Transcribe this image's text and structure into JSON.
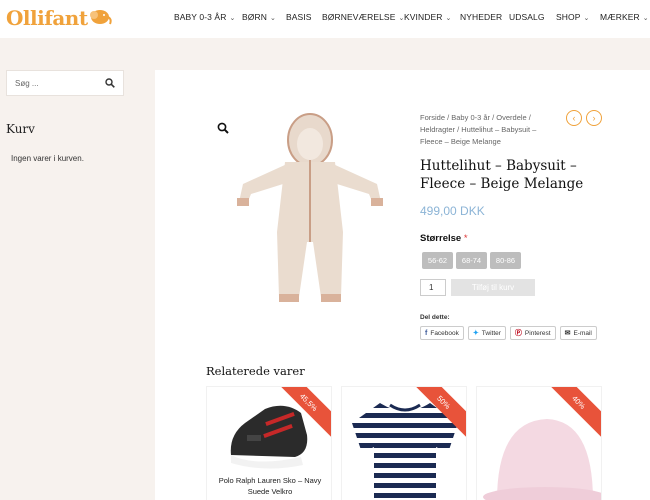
{
  "brand": {
    "name": "Ollifant",
    "accent_color": "#f0a23b"
  },
  "nav": [
    {
      "label": "BABY 0-3 ÅR",
      "has_dropdown": true
    },
    {
      "label": "BØRN",
      "has_dropdown": true
    },
    {
      "label": "BASIS",
      "has_dropdown": false
    },
    {
      "label": "BØRNEVÆRELSE",
      "has_dropdown": true
    },
    {
      "label": "KVINDER",
      "has_dropdown": true
    },
    {
      "label": "NYHEDER",
      "has_dropdown": false
    },
    {
      "label": "UDSALG",
      "has_dropdown": false
    },
    {
      "label": "SHOP",
      "has_dropdown": true
    },
    {
      "label": "MÆRKER",
      "has_dropdown": true
    }
  ],
  "sidebar": {
    "search_placeholder": "Søg ...",
    "cart_title": "Kurv",
    "cart_empty": "Ingen varer i kurven."
  },
  "product": {
    "breadcrumb": "Forside / Baby 0-3 år / Overdele / Heldragter / Huttelihut – Babysuit – Fleece – Beige Melange",
    "title": "Huttelihut – Babysuit – Fleece – Beige Melange",
    "price": "499,00 DKK",
    "price_color": "#8cb4d6",
    "size_label": "Størrelse",
    "required_mark": "*",
    "sizes": [
      "56-62",
      "68-74",
      "80-86"
    ],
    "quantity": "1",
    "add_to_cart": "Tilføj til kurv"
  },
  "share": {
    "label": "Del dette:",
    "buttons": [
      {
        "icon": "facebook-icon",
        "label": "Facebook"
      },
      {
        "icon": "twitter-icon",
        "label": "Twitter"
      },
      {
        "icon": "pinterest-icon",
        "label": "Pinterest"
      },
      {
        "icon": "email-icon",
        "label": "E-mail"
      }
    ]
  },
  "related": {
    "title": "Relaterede varer",
    "badge_color": "#e8533a",
    "items": [
      {
        "name": "Polo Ralph Lauren Sko – Navy Suede Velkro",
        "discount": "45,5%"
      },
      {
        "name": "",
        "discount": "50%"
      },
      {
        "name": "",
        "discount": "40%"
      }
    ]
  }
}
